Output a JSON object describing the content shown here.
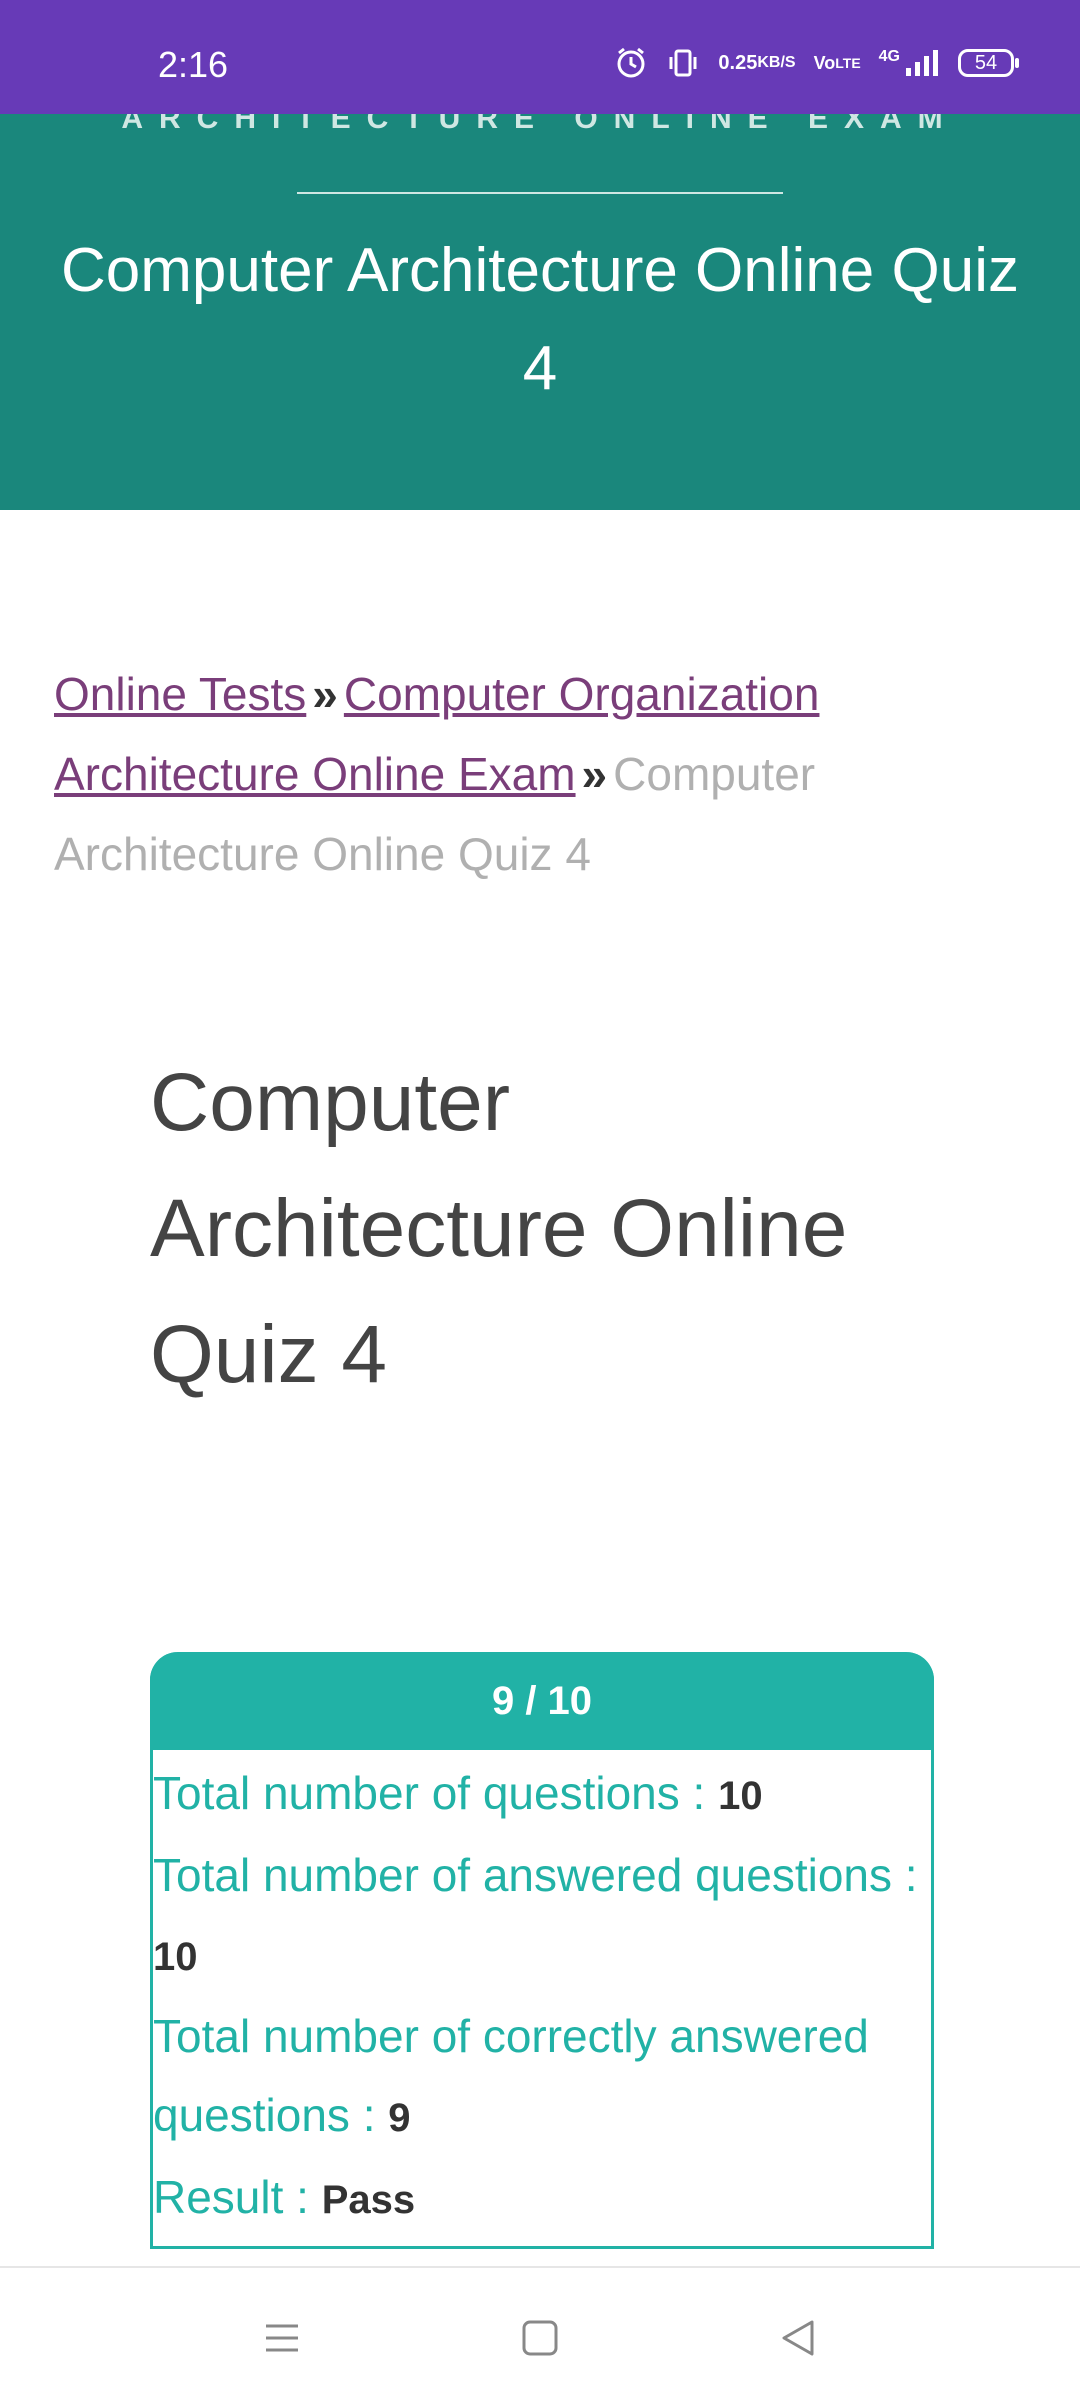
{
  "status_bar": {
    "time": "2:16",
    "net_speed_value": "0.25",
    "net_speed_unit": "KB/S",
    "volte_top": "Vo",
    "volte_bottom": "LTE",
    "network": "4G",
    "battery": "54"
  },
  "hero": {
    "kicker": "ARCHITECTURE ONLINE EXAM",
    "title": "Computer Architecture Online Quiz 4"
  },
  "breadcrumb": {
    "link1": "Online Tests",
    "separator": "»",
    "link2": "Computer Organization Architecture Online Exam",
    "current": "Computer Architecture Online Quiz 4"
  },
  "page_title": "Computer Architecture Online Quiz 4",
  "result": {
    "score": "9 / 10",
    "total_label": "Total number of questions : ",
    "total_value": "10",
    "answered_label": "Total number of answered questions : ",
    "answered_value": "10",
    "correct_label": "Total number of correctly answered questions : ",
    "correct_value": "9",
    "result_label": "Result : ",
    "result_value": "Pass"
  },
  "colors": {
    "status_bar": "#673ab7",
    "hero_bg": "#1a877c",
    "card_accent": "#21b2a6",
    "link": "#7a3e7a"
  },
  "nav": {
    "menu_icon": "menu-icon",
    "home_icon": "home-square-icon",
    "back_icon": "back-triangle-icon"
  }
}
